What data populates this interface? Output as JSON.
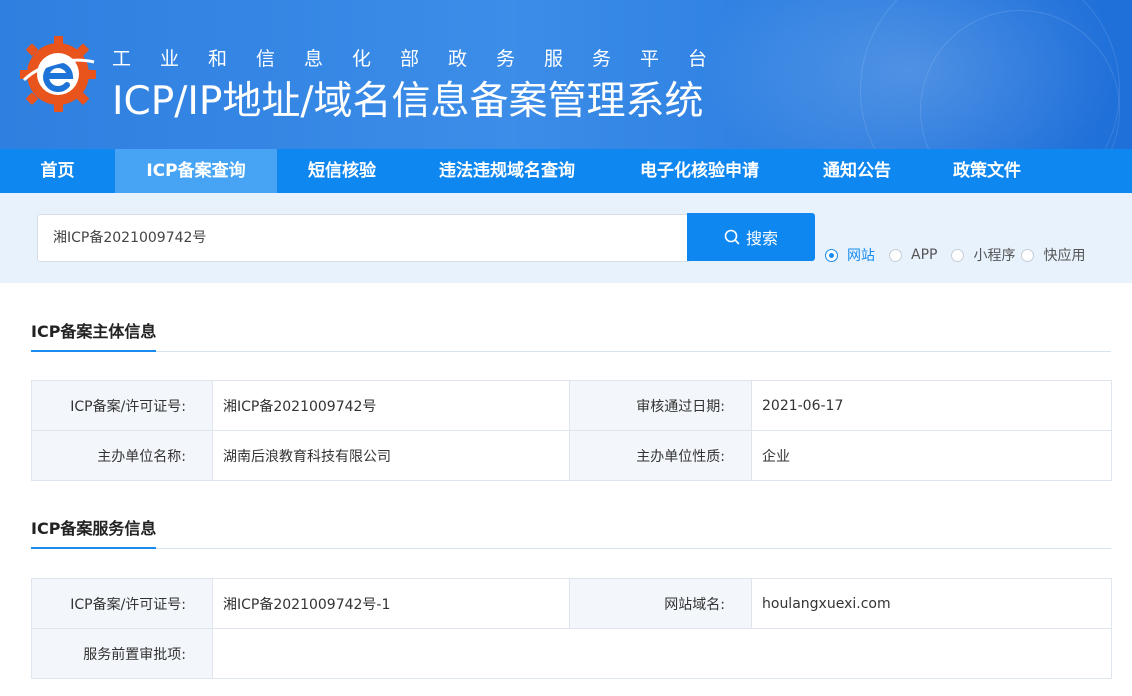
{
  "header": {
    "subtitle": "工业和信息化部政务服务平台",
    "title": "ICP/IP地址/域名信息备案管理系统"
  },
  "nav": {
    "items": [
      {
        "label": "首页",
        "active": false
      },
      {
        "label": "ICP备案查询",
        "active": true
      },
      {
        "label": "短信核验",
        "active": false
      },
      {
        "label": "违法违规域名查询",
        "active": false
      },
      {
        "label": "电子化核验申请",
        "active": false
      },
      {
        "label": "通知公告",
        "active": false
      },
      {
        "label": "政策文件",
        "active": false
      }
    ]
  },
  "search": {
    "value": "湘ICP备2021009742号",
    "button_label": "搜索",
    "options": [
      {
        "label": "网站",
        "checked": true
      },
      {
        "label": "APP",
        "checked": false
      },
      {
        "label": "小程序",
        "checked": false
      },
      {
        "label": "快应用",
        "checked": false
      }
    ]
  },
  "subject_info": {
    "title": "ICP备案主体信息",
    "rows": [
      {
        "label1": "ICP备案/许可证号:",
        "value1": "湘ICP备2021009742号",
        "label2": "审核通过日期:",
        "value2": "2021-06-17"
      },
      {
        "label1": "主办单位名称:",
        "value1": "湖南后浪教育科技有限公司",
        "label2": "主办单位性质:",
        "value2": "企业"
      }
    ]
  },
  "service_info": {
    "title": "ICP备案服务信息",
    "rows": [
      {
        "label1": "ICP备案/许可证号:",
        "value1": "湘ICP备2021009742号-1",
        "label2": "网站域名:",
        "value2": "houlangxuexi.com"
      },
      {
        "label1": "服务前置审批项:",
        "value1": ""
      }
    ]
  },
  "colors": {
    "nav_bg": "#0f87f0",
    "nav_active": "#47a4f5",
    "accent": "#1a8cf0",
    "search_strip_bg": "#e7f2fc"
  }
}
